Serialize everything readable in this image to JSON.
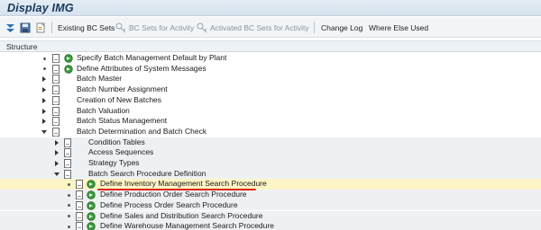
{
  "window": {
    "title": "Display IMG"
  },
  "toolbar": {
    "existing_bc_sets": "Existing BC Sets",
    "bc_sets_for_activity": "BC Sets for Activity",
    "activated_bc_sets": "Activated BC Sets for Activity",
    "change_log": "Change Log",
    "where_else_used": "Where Else Used"
  },
  "structure": {
    "header": "Structure"
  },
  "tree": {
    "items": [
      {
        "label": "Specify Batch Management Default by Plant",
        "kind": "activity"
      },
      {
        "label": "Define Attributes of System Messages",
        "kind": "activity"
      },
      {
        "label": "Batch Master",
        "kind": "folder"
      },
      {
        "label": "Batch Number Assignment",
        "kind": "folder"
      },
      {
        "label": "Creation of New Batches",
        "kind": "folder"
      },
      {
        "label": "Batch Valuation",
        "kind": "folder"
      },
      {
        "label": "Batch Status Management",
        "kind": "folder"
      },
      {
        "label": "Batch Determination and Batch Check",
        "kind": "folder-open"
      },
      {
        "label": "Condition Tables",
        "kind": "folder"
      },
      {
        "label": "Access Sequences",
        "kind": "folder"
      },
      {
        "label": "Strategy Types",
        "kind": "folder"
      },
      {
        "label": "Batch Search Procedure Definition",
        "kind": "folder-open"
      },
      {
        "label": "Define Inventory Management Search Procedure",
        "kind": "activity",
        "selected": true
      },
      {
        "label": "Define Production Order Search Procedure",
        "kind": "activity"
      },
      {
        "label": "Define Process Order Search Procedure",
        "kind": "activity"
      },
      {
        "label": "Define Sales and Distribution Search Procedure",
        "kind": "activity"
      },
      {
        "label": "Define Warehouse Management Search Procedure",
        "kind": "activity"
      }
    ]
  },
  "colors": {
    "title": "#16375a",
    "selection": "#fdf5c6",
    "underline": "#e2231a",
    "exec_green": "#3c9a3c"
  }
}
